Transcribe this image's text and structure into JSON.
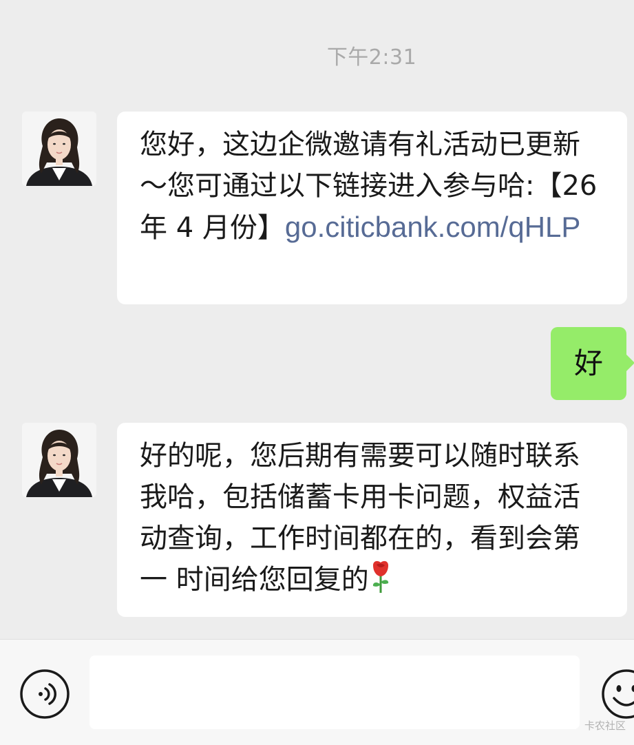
{
  "chat": {
    "timestamp": "下午2:31",
    "messages": [
      {
        "sender": "other",
        "text": "您好，这边企微邀请有礼活动已更新～您可通过以下链接进入参与哈:【26 年 4 月份】",
        "link": "go.citicbank.com/qHLP"
      },
      {
        "sender": "me",
        "text": "好"
      },
      {
        "sender": "other",
        "text": "好的呢，您后期有需要可以随时联系我哈，包括储蓄卡用卡问题，权益活动查询，工作时间都在的，看到会第 一 时间给您回复的",
        "emoji": "rose"
      }
    ]
  },
  "inputbar": {
    "voice_icon": "voice-icon",
    "emoji_icon": "emoji-icon",
    "watermark": "卡农社区"
  },
  "colors": {
    "background": "#ededed",
    "bubble_other": "#ffffff",
    "bubble_me": "#95ec69",
    "link": "#576b95",
    "timestamp": "#a9a9a9"
  }
}
